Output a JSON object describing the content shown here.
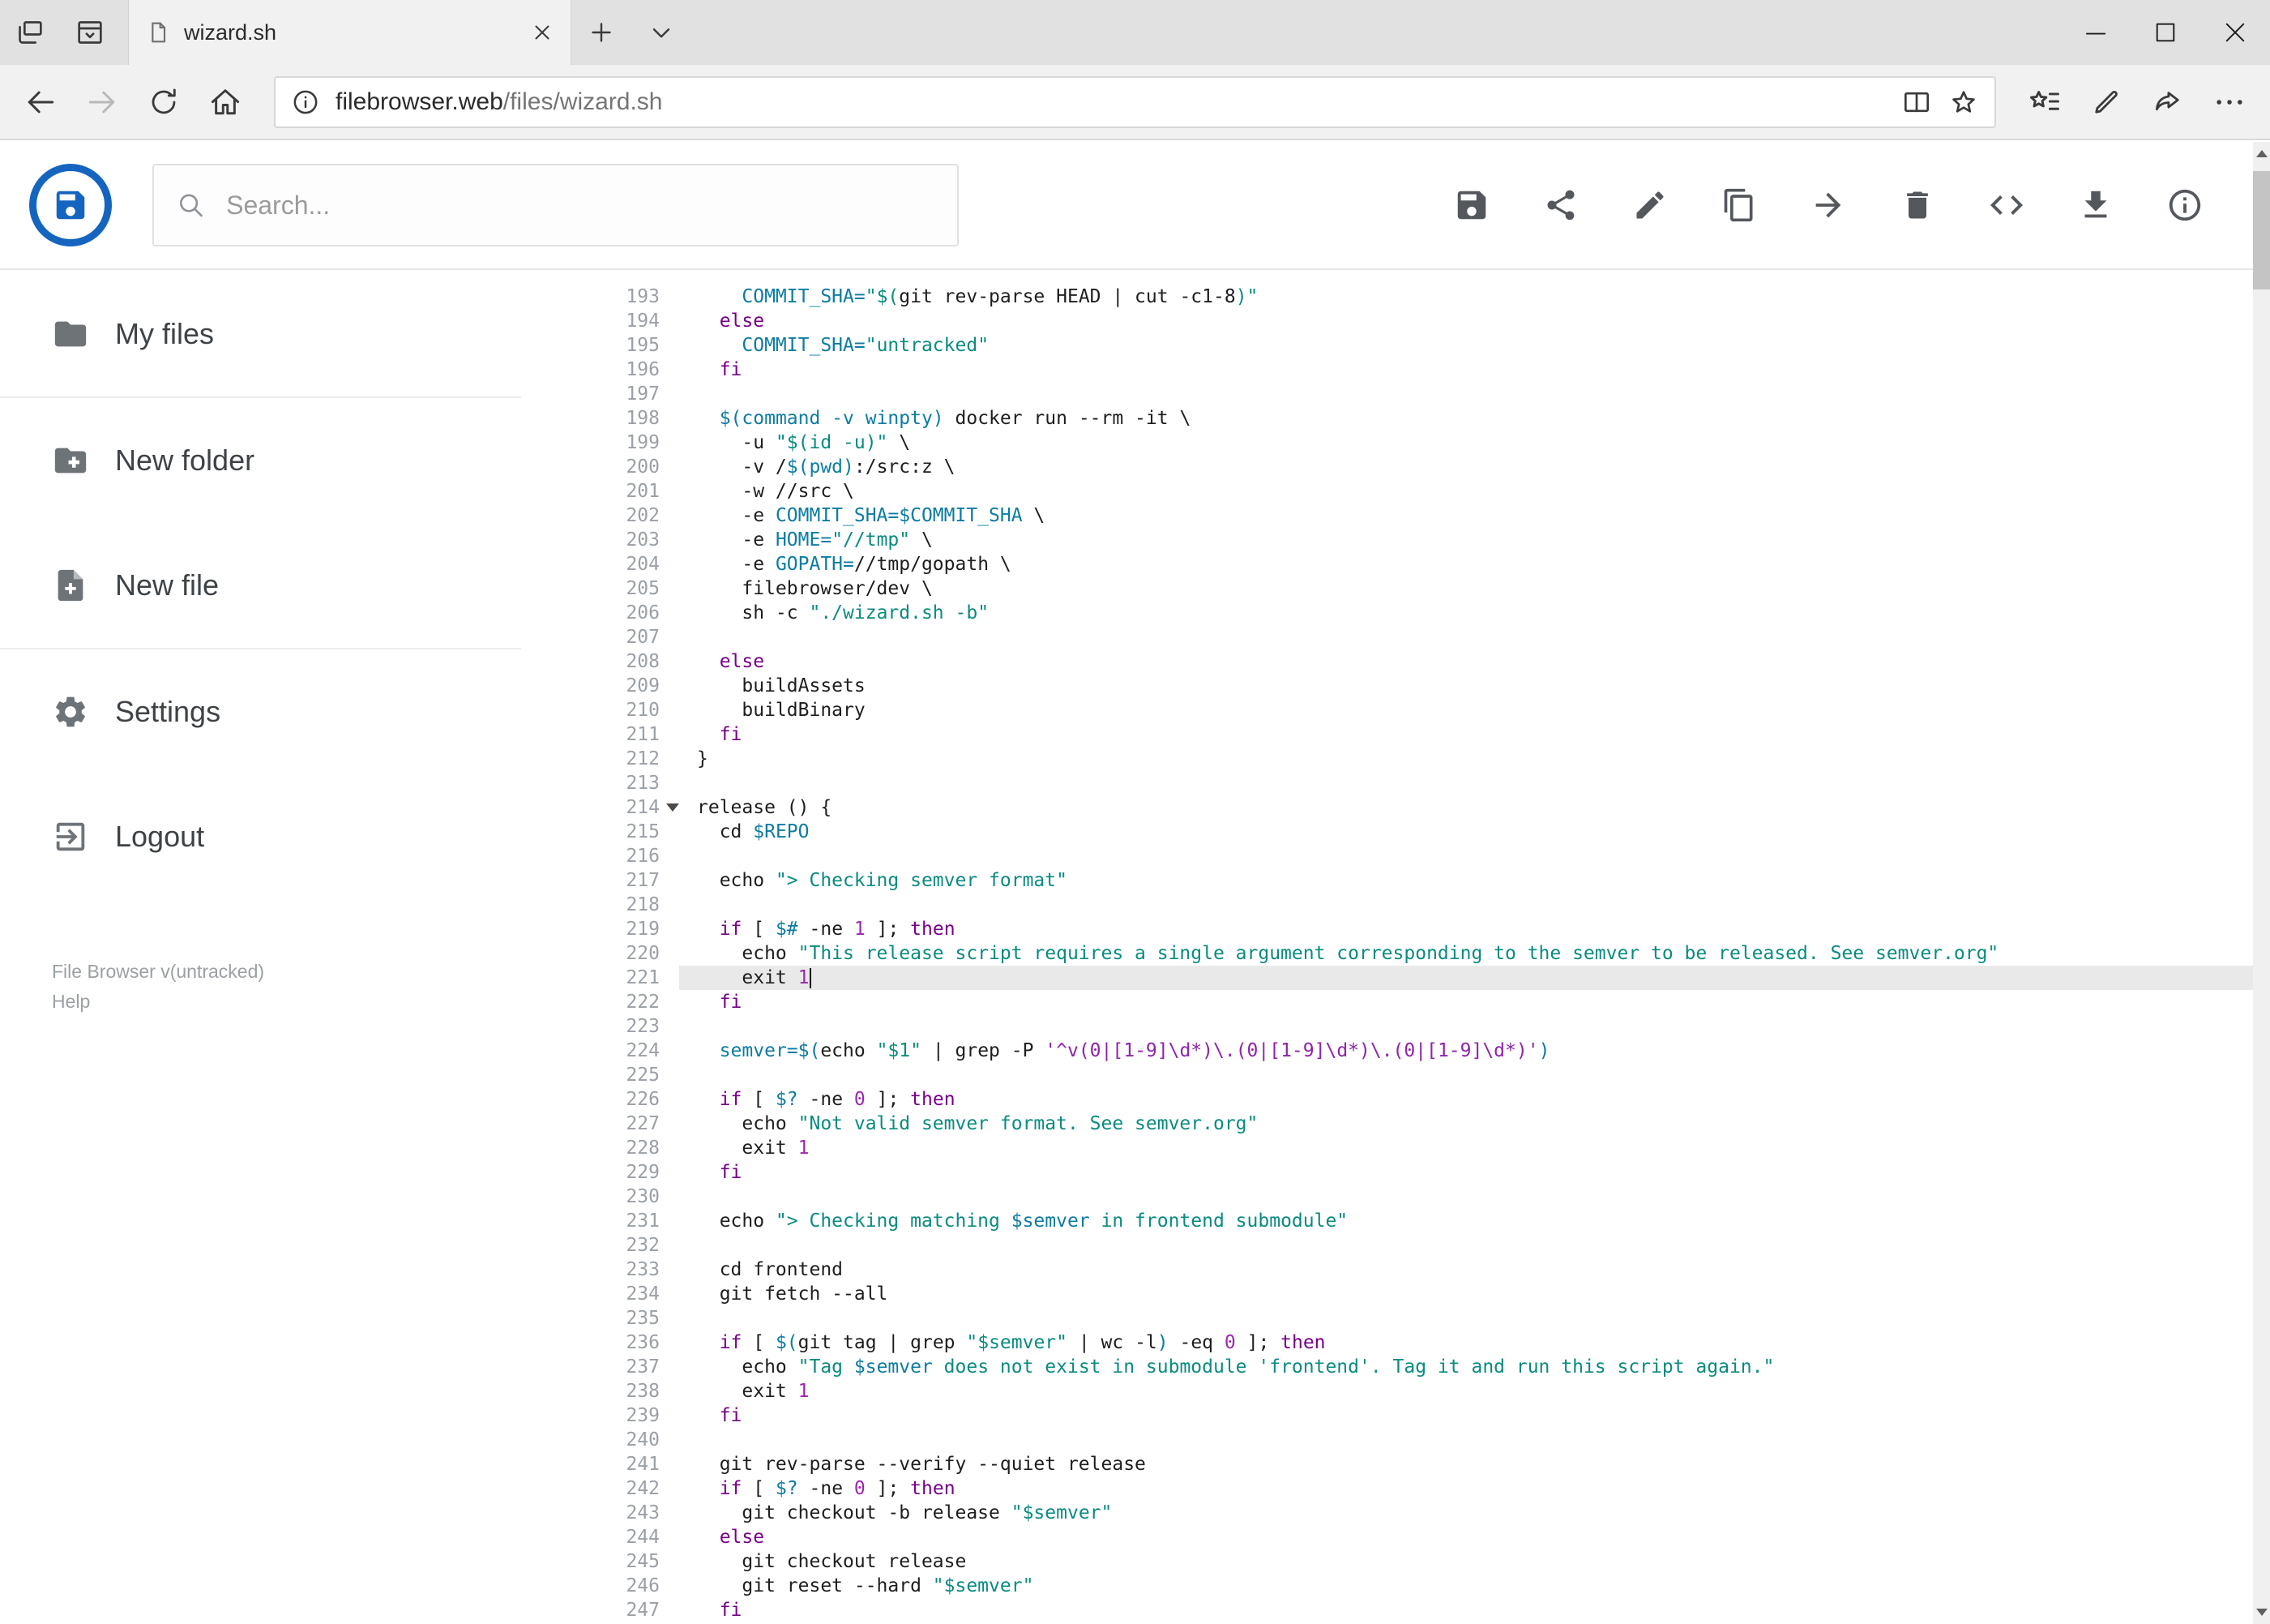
{
  "browser": {
    "tab_title": "wizard.sh",
    "url": {
      "host": "filebrowser.web",
      "path": "/files/wizard.sh"
    }
  },
  "header": {
    "search_placeholder": "Search...",
    "action_icons": [
      "save",
      "share",
      "edit",
      "copy",
      "move",
      "delete",
      "raw-code",
      "download",
      "info"
    ]
  },
  "sidebar": {
    "items": [
      {
        "label": "My files",
        "icon": "folder-icon"
      },
      {
        "label": "New folder",
        "icon": "new-folder-icon"
      },
      {
        "label": "New file",
        "icon": "new-file-icon"
      },
      {
        "label": "Settings",
        "icon": "settings-icon"
      },
      {
        "label": "Logout",
        "icon": "logout-icon"
      }
    ],
    "footer_version": "File Browser v(untracked)",
    "footer_help": "Help"
  },
  "editor": {
    "language": "shell",
    "first_line": 193,
    "last_line": 247,
    "active_line": 221,
    "cursor_line": 221,
    "fold_line": 214,
    "lines": [
      {
        "n": 193,
        "t": [
          [
            "p",
            "    "
          ],
          [
            "v",
            "COMMIT_SHA="
          ],
          [
            "s",
            "\"$("
          ],
          [
            "p",
            "git rev-parse HEAD | cut -c1-8"
          ],
          [
            "s",
            ")\""
          ]
        ]
      },
      {
        "n": 194,
        "t": [
          [
            "p",
            "  "
          ],
          [
            "k",
            "else"
          ]
        ]
      },
      {
        "n": 195,
        "t": [
          [
            "p",
            "    "
          ],
          [
            "v",
            "COMMIT_SHA="
          ],
          [
            "s",
            "\"untracked\""
          ]
        ]
      },
      {
        "n": 196,
        "t": [
          [
            "p",
            "  "
          ],
          [
            "k",
            "fi"
          ]
        ]
      },
      {
        "n": 197,
        "t": []
      },
      {
        "n": 198,
        "t": [
          [
            "p",
            "  "
          ],
          [
            "v",
            "$(command -v winpty)"
          ],
          [
            "p",
            " docker run --rm -it \\"
          ]
        ]
      },
      {
        "n": 199,
        "t": [
          [
            "p",
            "    -u "
          ],
          [
            "s",
            "\"$(id -u)\""
          ],
          [
            "p",
            " \\"
          ]
        ]
      },
      {
        "n": 200,
        "t": [
          [
            "p",
            "    -v /"
          ],
          [
            "v",
            "$(pwd)"
          ],
          [
            "p",
            ":/src:z \\"
          ]
        ]
      },
      {
        "n": 201,
        "t": [
          [
            "p",
            "    -w //src \\"
          ]
        ]
      },
      {
        "n": 202,
        "t": [
          [
            "p",
            "    -e "
          ],
          [
            "v",
            "COMMIT_SHA=$COMMIT_SHA"
          ],
          [
            "p",
            " \\"
          ]
        ]
      },
      {
        "n": 203,
        "t": [
          [
            "p",
            "    -e "
          ],
          [
            "v",
            "HOME="
          ],
          [
            "s",
            "\"//tmp\""
          ],
          [
            "p",
            " \\"
          ]
        ]
      },
      {
        "n": 204,
        "t": [
          [
            "p",
            "    -e "
          ],
          [
            "v",
            "GOPATH="
          ],
          [
            "p",
            "//tmp/gopath \\"
          ]
        ]
      },
      {
        "n": 205,
        "t": [
          [
            "p",
            "    filebrowser/dev \\"
          ]
        ]
      },
      {
        "n": 206,
        "t": [
          [
            "p",
            "    sh -c "
          ],
          [
            "s",
            "\"./wizard.sh -b\""
          ]
        ]
      },
      {
        "n": 207,
        "t": []
      },
      {
        "n": 208,
        "t": [
          [
            "p",
            "  "
          ],
          [
            "k",
            "else"
          ]
        ]
      },
      {
        "n": 209,
        "t": [
          [
            "p",
            "    buildAssets"
          ]
        ]
      },
      {
        "n": 210,
        "t": [
          [
            "p",
            "    buildBinary"
          ]
        ]
      },
      {
        "n": 211,
        "t": [
          [
            "p",
            "  "
          ],
          [
            "k",
            "fi"
          ]
        ]
      },
      {
        "n": 212,
        "t": [
          [
            "p",
            "}"
          ]
        ]
      },
      {
        "n": 213,
        "t": []
      },
      {
        "n": 214,
        "t": [
          [
            "p",
            "release () {"
          ]
        ]
      },
      {
        "n": 215,
        "t": [
          [
            "p",
            "  cd "
          ],
          [
            "v",
            "$REPO"
          ]
        ]
      },
      {
        "n": 216,
        "t": []
      },
      {
        "n": 217,
        "t": [
          [
            "p",
            "  echo "
          ],
          [
            "s",
            "\"> Checking semver format\""
          ]
        ]
      },
      {
        "n": 218,
        "t": []
      },
      {
        "n": 219,
        "t": [
          [
            "p",
            "  "
          ],
          [
            "k",
            "if"
          ],
          [
            "p",
            " [ "
          ],
          [
            "v",
            "$#"
          ],
          [
            "p",
            " -ne "
          ],
          [
            "n",
            "1"
          ],
          [
            "p",
            " ]; "
          ],
          [
            "k",
            "then"
          ]
        ]
      },
      {
        "n": 220,
        "t": [
          [
            "p",
            "    echo "
          ],
          [
            "s",
            "\"This release script requires a single argument corresponding to the semver to be released. See semver.org\""
          ]
        ]
      },
      {
        "n": 221,
        "t": [
          [
            "p",
            "    exit "
          ],
          [
            "n",
            "1"
          ]
        ]
      },
      {
        "n": 222,
        "t": [
          [
            "p",
            "  "
          ],
          [
            "k",
            "fi"
          ]
        ]
      },
      {
        "n": 223,
        "t": []
      },
      {
        "n": 224,
        "t": [
          [
            "p",
            "  "
          ],
          [
            "v",
            "semver=$("
          ],
          [
            "p",
            "echo "
          ],
          [
            "s",
            "\"$1\""
          ],
          [
            "p",
            " | grep -P "
          ],
          [
            "r",
            "'^v(0|[1-9]\\d*)\\.(0|[1-9]\\d*)\\.(0|[1-9]\\d*)'"
          ],
          [
            "v",
            ")"
          ]
        ]
      },
      {
        "n": 225,
        "t": []
      },
      {
        "n": 226,
        "t": [
          [
            "p",
            "  "
          ],
          [
            "k",
            "if"
          ],
          [
            "p",
            " [ "
          ],
          [
            "v",
            "$?"
          ],
          [
            "p",
            " -ne "
          ],
          [
            "n",
            "0"
          ],
          [
            "p",
            " ]; "
          ],
          [
            "k",
            "then"
          ]
        ]
      },
      {
        "n": 227,
        "t": [
          [
            "p",
            "    echo "
          ],
          [
            "s",
            "\"Not valid semver format. See semver.org\""
          ]
        ]
      },
      {
        "n": 228,
        "t": [
          [
            "p",
            "    exit "
          ],
          [
            "n",
            "1"
          ]
        ]
      },
      {
        "n": 229,
        "t": [
          [
            "p",
            "  "
          ],
          [
            "k",
            "fi"
          ]
        ]
      },
      {
        "n": 230,
        "t": []
      },
      {
        "n": 231,
        "t": [
          [
            "p",
            "  echo "
          ],
          [
            "s",
            "\"> Checking matching "
          ],
          [
            "v",
            "$semver"
          ],
          [
            "s",
            " in frontend submodule\""
          ]
        ]
      },
      {
        "n": 232,
        "t": []
      },
      {
        "n": 233,
        "t": [
          [
            "p",
            "  cd frontend"
          ]
        ]
      },
      {
        "n": 234,
        "t": [
          [
            "p",
            "  git fetch --all"
          ]
        ]
      },
      {
        "n": 235,
        "t": []
      },
      {
        "n": 236,
        "t": [
          [
            "p",
            "  "
          ],
          [
            "k",
            "if"
          ],
          [
            "p",
            " [ "
          ],
          [
            "v",
            "$("
          ],
          [
            "p",
            "git tag | grep "
          ],
          [
            "s",
            "\"$semver\""
          ],
          [
            "p",
            " | wc -l"
          ],
          [
            "v",
            ")"
          ],
          [
            "p",
            " -eq "
          ],
          [
            "n",
            "0"
          ],
          [
            "p",
            " ]; "
          ],
          [
            "k",
            "then"
          ]
        ]
      },
      {
        "n": 237,
        "t": [
          [
            "p",
            "    echo "
          ],
          [
            "s",
            "\"Tag "
          ],
          [
            "v",
            "$semver"
          ],
          [
            "s",
            " does not exist in submodule 'frontend'. Tag it and run this script again.\""
          ]
        ]
      },
      {
        "n": 238,
        "t": [
          [
            "p",
            "    exit "
          ],
          [
            "n",
            "1"
          ]
        ]
      },
      {
        "n": 239,
        "t": [
          [
            "p",
            "  "
          ],
          [
            "k",
            "fi"
          ]
        ]
      },
      {
        "n": 240,
        "t": []
      },
      {
        "n": 241,
        "t": [
          [
            "p",
            "  git rev-parse --verify --quiet release"
          ]
        ]
      },
      {
        "n": 242,
        "t": [
          [
            "p",
            "  "
          ],
          [
            "k",
            "if"
          ],
          [
            "p",
            " [ "
          ],
          [
            "v",
            "$?"
          ],
          [
            "p",
            " -ne "
          ],
          [
            "n",
            "0"
          ],
          [
            "p",
            " ]; "
          ],
          [
            "k",
            "then"
          ]
        ]
      },
      {
        "n": 243,
        "t": [
          [
            "p",
            "    git checkout -b release "
          ],
          [
            "s",
            "\"$semver\""
          ]
        ]
      },
      {
        "n": 244,
        "t": [
          [
            "p",
            "  "
          ],
          [
            "k",
            "else"
          ]
        ]
      },
      {
        "n": 245,
        "t": [
          [
            "p",
            "    git checkout release"
          ]
        ]
      },
      {
        "n": 246,
        "t": [
          [
            "p",
            "    git reset --hard "
          ],
          [
            "s",
            "\"$semver\""
          ]
        ]
      },
      {
        "n": 247,
        "t": [
          [
            "p",
            "  "
          ],
          [
            "k",
            "fi"
          ]
        ]
      }
    ]
  },
  "colors": {
    "accent": "#1565c0",
    "plain": "#1e1e1e",
    "keyword": "#770088",
    "string": "#0a8b80",
    "variable": "#0d7ca3",
    "number": "#9c27b0",
    "regex": "#8e24aa",
    "gutter": "#9aa0a6",
    "active_line_bg": "#e9e9e9"
  }
}
